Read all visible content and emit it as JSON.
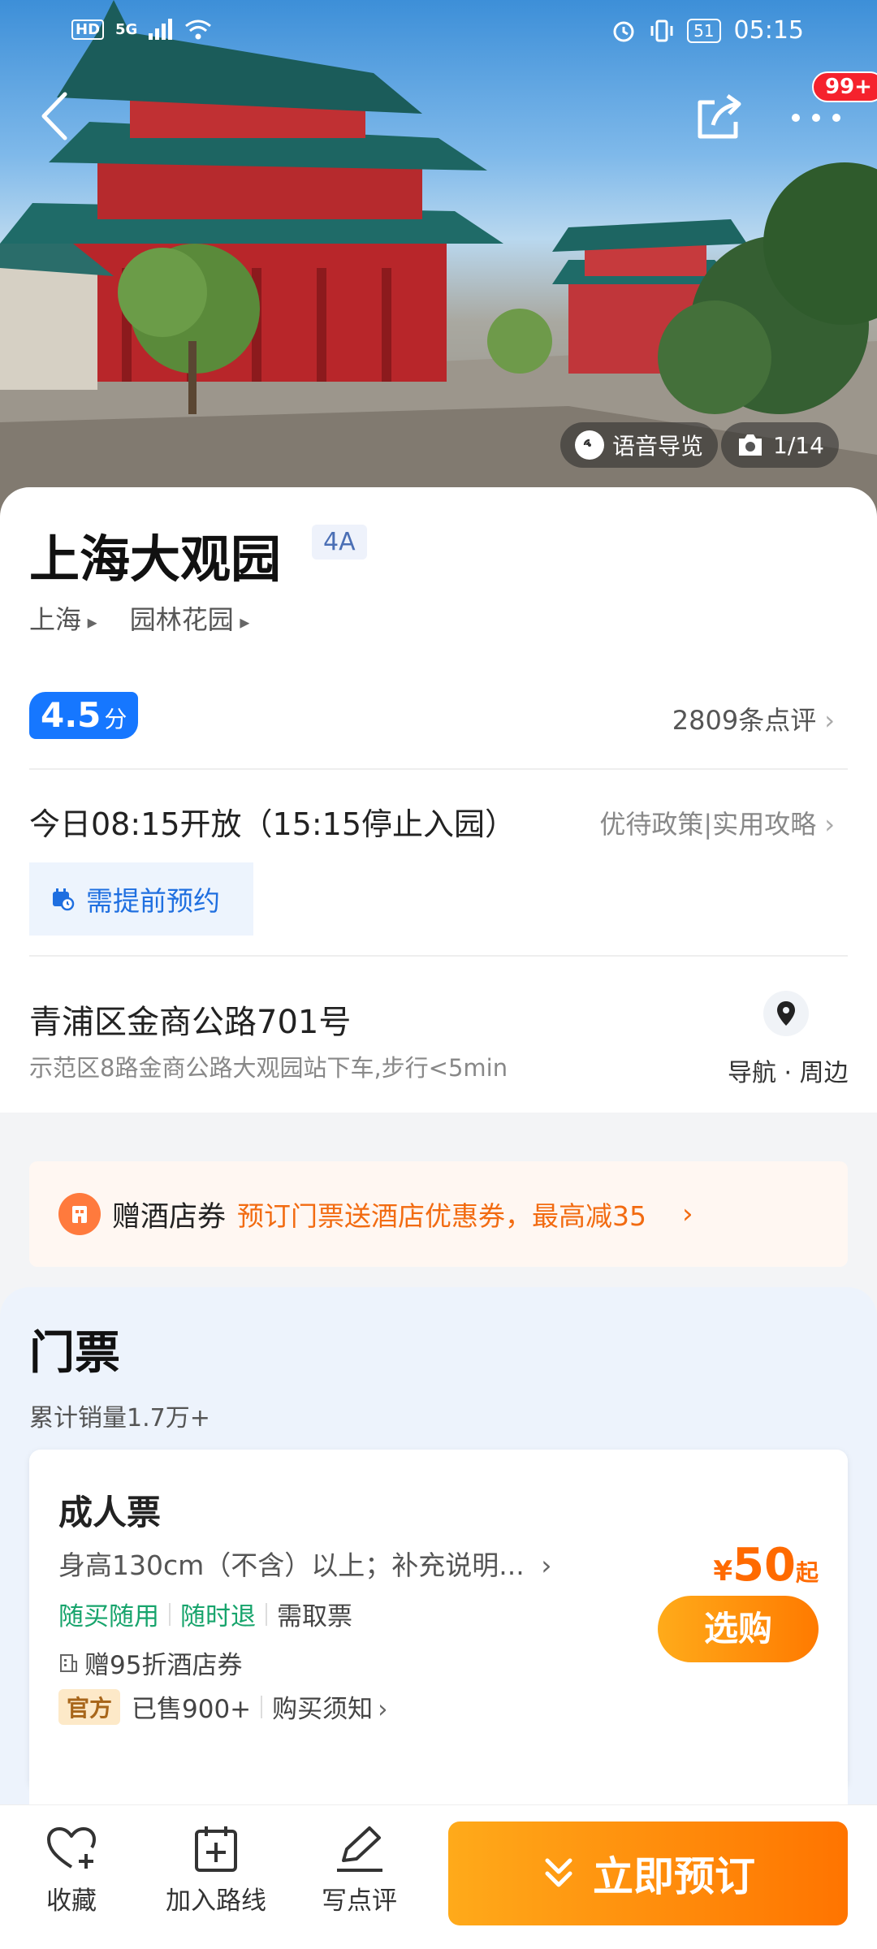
{
  "status_bar": {
    "hd": "HD",
    "network": "5G",
    "battery": "51",
    "time": "05:15"
  },
  "header": {
    "more_badge": "99+"
  },
  "hero": {
    "audio_guide": "语音导览",
    "photo_counter": "1/14"
  },
  "attraction": {
    "name": "上海大观园",
    "level": "4A",
    "breadcrumbs": [
      "上海",
      "园林花园"
    ],
    "rating": "4.5",
    "rating_unit": "分",
    "reviews": "2809条点评",
    "hours": "今日08:15开放（15:15停止入园）",
    "policy_link": "优待政策|实用攻略",
    "reservation_note": "需提前预约",
    "address": "青浦区金商公路701号",
    "transit": "示范区8路金商公路大观园站下车,步行<5min",
    "nav_label": "导航 · 周边"
  },
  "coupon": {
    "label": "赠酒店券",
    "text": "预订门票送酒店优惠券，最高减35"
  },
  "tickets": {
    "section_title": "门票",
    "total_sold": "累计销量1.7万+",
    "items": [
      {
        "name": "成人票",
        "desc": "身高130cm（不含）以上；补充说明...",
        "tags": [
          "随买随用",
          "随时退",
          "需取票"
        ],
        "gift": "赠95折酒店券",
        "official": "官方",
        "sold": "已售900+",
        "notice": "购买须知",
        "currency": "¥",
        "price": "50",
        "price_suffix": "起",
        "buy_label": "选购"
      }
    ]
  },
  "bottom_bar": {
    "favorite": "收藏",
    "add_route": "加入路线",
    "write_review": "写点评",
    "book_now": "立即预订"
  },
  "colors": {
    "primary_blue": "#1677ff",
    "accent_orange": "#ff7a00",
    "tag_green": "#17a46c"
  }
}
